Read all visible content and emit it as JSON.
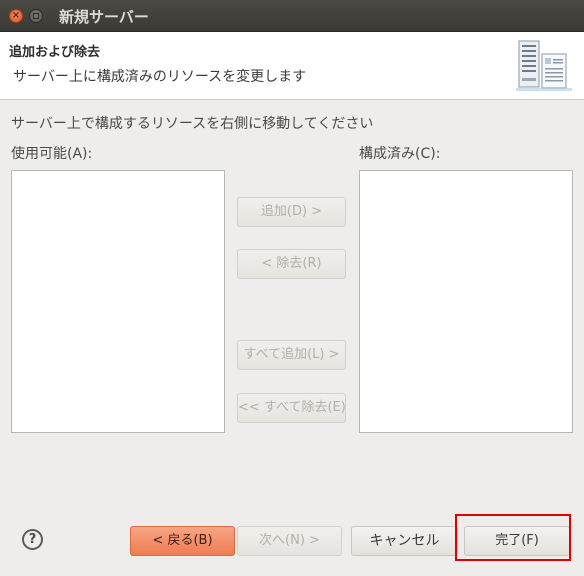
{
  "window": {
    "title": "新規サーバー",
    "close_icon": "close-icon",
    "maximize_icon": "maximize-icon"
  },
  "header": {
    "title": "追加および除去",
    "description": "サーバー上に構成済みのリソースを変更します",
    "image_icon": "server-icon"
  },
  "main": {
    "instruction": "サーバー上で構成するリソースを右側に移動してください",
    "available_label": "使用可能(A):",
    "configured_label": "構成済み(C):",
    "available_items": [],
    "configured_items": []
  },
  "transfer_buttons": {
    "add": "追加(D) >",
    "remove": "< 除去(R)",
    "add_all": "すべて追加(L) >",
    "remove_all": "<< すべて除去(E)"
  },
  "footer": {
    "help_icon": "help-icon",
    "help_glyph": "?",
    "back": "< 戻る(B)",
    "next": "次へ(N) >",
    "cancel": "キャンセル",
    "finish": "完了(F)"
  },
  "colors": {
    "highlight": "#e00000",
    "back_button": "#ef7c54",
    "titlebar": "#3b3a36"
  }
}
